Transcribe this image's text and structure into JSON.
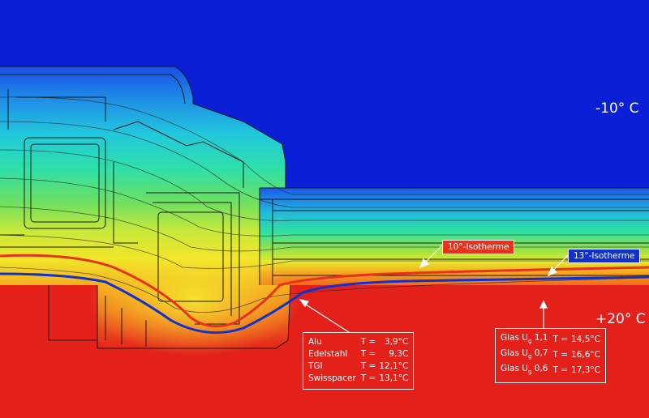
{
  "ambient": {
    "outside": "-10° C",
    "inside": "+20° C"
  },
  "isotherms": [
    {
      "label": "10°-Isotherme",
      "color": "#e8321e"
    },
    {
      "label": "13°-Isotherme",
      "color": "#1030d0"
    }
  ],
  "spacers": [
    {
      "name": "Alu",
      "temp_prefix": "T =",
      "temp": "3,9°C"
    },
    {
      "name": "Edelstahl",
      "temp_prefix": "T =",
      "temp": "9,3C"
    },
    {
      "name": "TGI",
      "temp_prefix": "T =",
      "temp": "12,1°C"
    },
    {
      "name": "Swisspacer",
      "temp_prefix": "T =",
      "temp": "13,1°C"
    }
  ],
  "glazing": [
    {
      "name": "Glas U",
      "sub": "g",
      "uvalue": "1,1",
      "temp_prefix": "T =",
      "temp": "14,5°C"
    },
    {
      "name": "Glas U",
      "sub": "g",
      "uvalue": "0,7",
      "temp_prefix": "T =",
      "temp": "16,6°C"
    },
    {
      "name": "Glas U",
      "sub": "g",
      "uvalue": "0,6",
      "temp_prefix": "T =",
      "temp": "17,3°C"
    }
  ],
  "colors": {
    "cold": "#0a1fd6",
    "warm": "#e4201b"
  }
}
